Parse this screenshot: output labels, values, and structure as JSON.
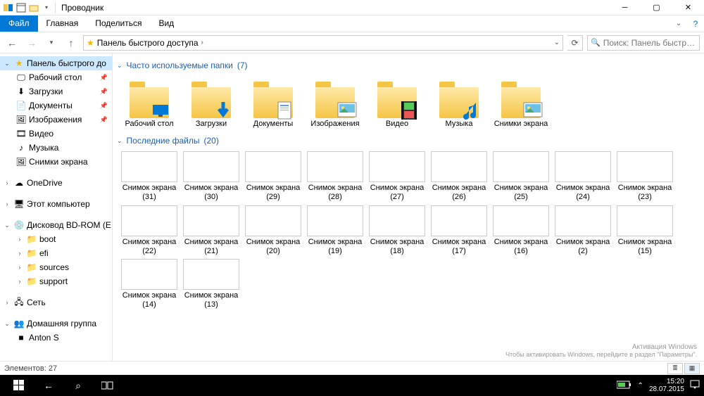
{
  "title_bar": {
    "app_title": "Проводник"
  },
  "ribbon": {
    "file": "Файл",
    "tabs": [
      "Главная",
      "Поделиться",
      "Вид"
    ]
  },
  "address": {
    "breadcrumb": "Панель быстрого доступа",
    "search_placeholder": "Поиск: Панель быстрого досту...",
    "chev_separator": "›"
  },
  "nav": {
    "quick_access": "Панель быстрого до",
    "quick_items": [
      {
        "label": "Рабочий стол",
        "pinned": true
      },
      {
        "label": "Загрузки",
        "pinned": true
      },
      {
        "label": "Документы",
        "pinned": true
      },
      {
        "label": "Изображения",
        "pinned": true
      },
      {
        "label": "Видео",
        "pinned": false
      },
      {
        "label": "Музыка",
        "pinned": false
      },
      {
        "label": "Снимки экрана",
        "pinned": false
      }
    ],
    "onedrive": "OneDrive",
    "this_pc": "Этот компьютер",
    "drive": "Дисковод BD-ROM (E",
    "drive_items": [
      "boot",
      "efi",
      "sources",
      "support"
    ],
    "network": "Сеть",
    "homegroup": "Домашняя группа",
    "homegroup_items": [
      "Anton S"
    ]
  },
  "content": {
    "group_folders_label": "Часто используемые папки",
    "group_folders_count": "(7)",
    "folders": [
      {
        "name": "Рабочий стол",
        "overlay": "desktop"
      },
      {
        "name": "Загрузки",
        "overlay": "download"
      },
      {
        "name": "Документы",
        "overlay": "document"
      },
      {
        "name": "Изображения",
        "overlay": "picture"
      },
      {
        "name": "Видео",
        "overlay": "video"
      },
      {
        "name": "Музыка",
        "overlay": "music"
      },
      {
        "name": "Снимки экрана",
        "overlay": "picture"
      }
    ],
    "group_files_label": "Последние файлы",
    "group_files_count": "(20)",
    "files": [
      {
        "name": "Снимок экрана (31)",
        "th": "th-white"
      },
      {
        "name": "Снимок экрана (30)",
        "th": "th-img"
      },
      {
        "name": "Снимок экрана (29)",
        "th": "th-white"
      },
      {
        "name": "Снимок экрана (28)",
        "th": "th-tiles"
      },
      {
        "name": "Снимок экрана (27)",
        "th": "th-img"
      },
      {
        "name": "Снимок экрана (26)",
        "th": "th-dark"
      },
      {
        "name": "Снимок экрана (25)",
        "th": "th-dark"
      },
      {
        "name": "Снимок экрана (24)",
        "th": "th-img"
      },
      {
        "name": "Снимок экрана (23)",
        "th": "th-pink"
      },
      {
        "name": "Снимок экрана (22)",
        "th": "th-white"
      },
      {
        "name": "Снимок экрана (21)",
        "th": "th-white"
      },
      {
        "name": "Снимок экрана (20)",
        "th": "th-pink"
      },
      {
        "name": "Снимок экрана (19)",
        "th": "th-pink"
      },
      {
        "name": "Снимок экрана (18)",
        "th": "th-tiles"
      },
      {
        "name": "Снимок экрана (17)",
        "th": "th-map"
      },
      {
        "name": "Снимок экрана (16)",
        "th": "th-white"
      },
      {
        "name": "Снимок экрана (2)",
        "th": "th-img"
      },
      {
        "name": "Снимок экрана (15)",
        "th": "th-img"
      },
      {
        "name": "Снимок экрана (14)",
        "th": "th-blue"
      },
      {
        "name": "Снимок экрана (13)",
        "th": "th-img"
      }
    ]
  },
  "status": {
    "items_label": "Элементов:",
    "items_count": "27"
  },
  "watermark": {
    "line1": "Активация Windows",
    "line2": "Чтобы активировать Windows, перейдите в раздел \"Параметры\"."
  },
  "taskbar": {
    "time": "15:20",
    "date": "28.07.2015"
  }
}
